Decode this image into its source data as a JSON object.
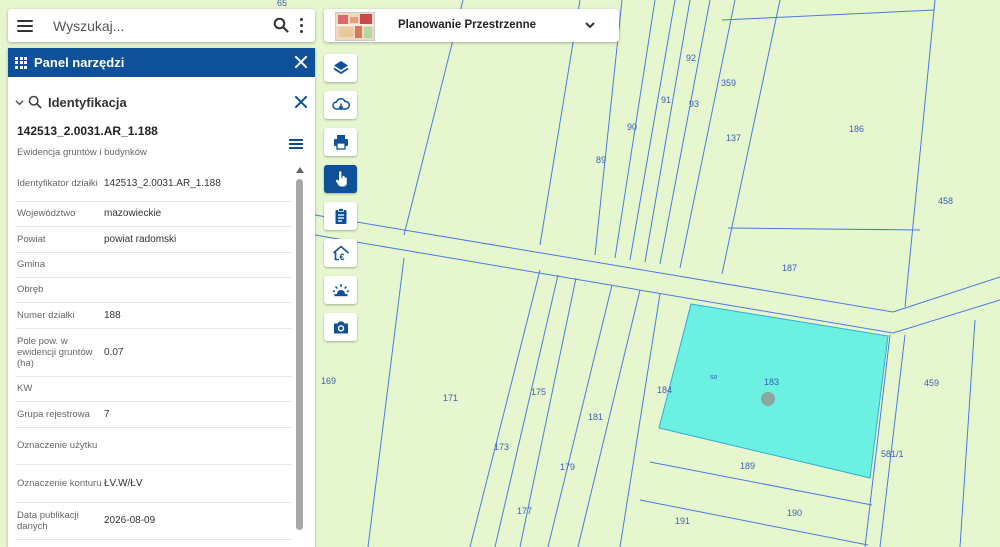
{
  "search": {
    "placeholder": "Wyszukaj..."
  },
  "tools_panel": {
    "title": "Panel narzędzi"
  },
  "identification": {
    "title": "Identyfikacja",
    "object_id": "142513_2.0031.AR_1.188",
    "layer_name": "Ewidencja gruntów i budynków",
    "attributes": [
      {
        "label": "Identyfikator działki",
        "value": "142513_2.0031.AR_1.188"
      },
      {
        "label": "Województwo",
        "value": "mazowieckie"
      },
      {
        "label": "Powiat",
        "value": "powiat radomski"
      },
      {
        "label": "Gmina",
        "value": ""
      },
      {
        "label": "Obręb",
        "value": ""
      },
      {
        "label": "Numer działki",
        "value": "188"
      },
      {
        "label": "Pole pow. w ewidencji gruntów (ha)",
        "value": "0.07"
      },
      {
        "label": "KW",
        "value": ""
      },
      {
        "label": "Grupa rejestrowa",
        "value": "7"
      },
      {
        "label": "Oznaczenie użytku",
        "value": ""
      },
      {
        "label": "Oznaczenie konturu",
        "value": "ŁV.W/ŁV"
      },
      {
        "label": "Data publikacji danych",
        "value": "2026-08-09"
      }
    ]
  },
  "plan_select": {
    "label": "Planowanie Przestrzenne"
  },
  "toolbar": [
    {
      "name": "layers-button",
      "icon": "layers-icon",
      "active": false
    },
    {
      "name": "cloud-download-button",
      "icon": "cloud-download-icon",
      "active": false
    },
    {
      "name": "print-button",
      "icon": "printer-icon",
      "active": false
    },
    {
      "name": "identify-button",
      "icon": "hand-pointer-icon",
      "active": true
    },
    {
      "name": "clipboard-button",
      "icon": "clipboard-icon",
      "active": false
    },
    {
      "name": "property-value-button",
      "icon": "house-euro-icon",
      "active": false
    },
    {
      "name": "beacon-button",
      "icon": "siren-icon",
      "active": false
    },
    {
      "name": "screenshot-button",
      "icon": "camera-icon",
      "active": false
    }
  ],
  "colors": {
    "accent": "#0e5199",
    "map_bg": "#e6f7cf",
    "parcel_line": "#4a7be0",
    "selected_fill": "#66f0e2"
  },
  "map": {
    "parcel_labels": [
      "65",
      "92",
      "359",
      "91",
      "93",
      "90",
      "137",
      "186",
      "89",
      "458",
      "187",
      "so",
      "183",
      "184",
      "169",
      "171",
      "175",
      "181",
      "173",
      "179",
      "189",
      "581/1",
      "177",
      "191",
      "190",
      "459"
    ]
  }
}
